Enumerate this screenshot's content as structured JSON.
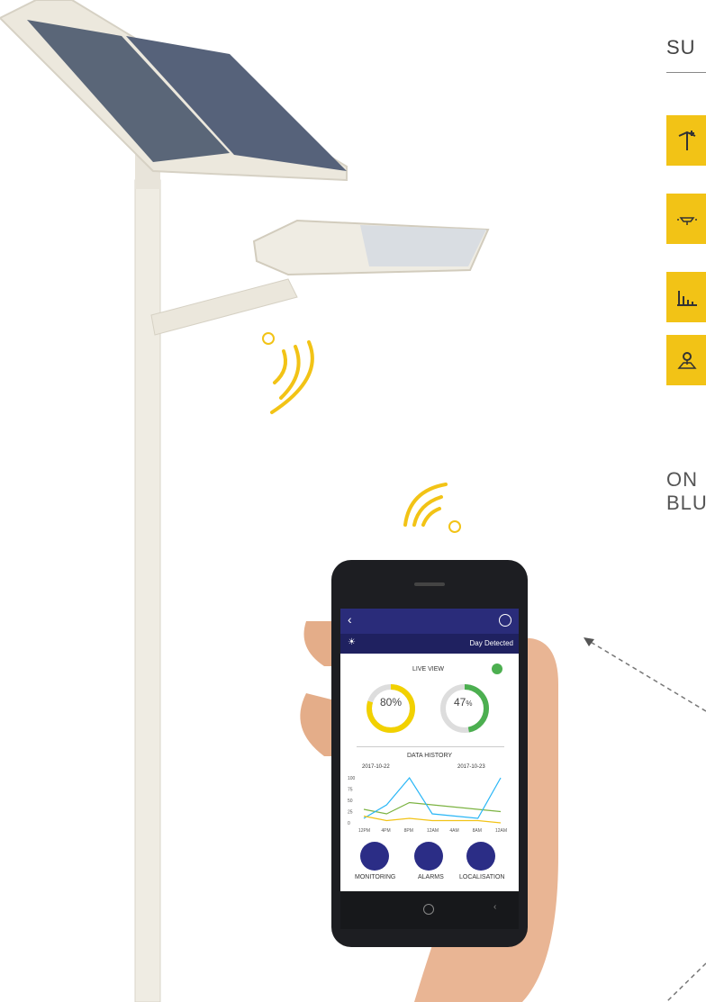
{
  "panel": {
    "title": "SU",
    "tiles": [
      "pole-icon",
      "lamp-icon",
      "bars-chart-icon",
      "map-pin-icon"
    ],
    "note": "ON\nBLU"
  },
  "app": {
    "status_text": "Day Detected",
    "live_view_label": "LIVE VIEW",
    "battery_percent": "80%",
    "charge_percent_value": "47",
    "charge_percent_unit": "%",
    "history_label": "DATA HISTORY",
    "date_left": "2017-10-22",
    "date_right": "2017-10-23",
    "y_ticks": [
      "100",
      "75",
      "50",
      "25",
      "0"
    ],
    "x_ticks": [
      "12PM",
      "4PM",
      "8PM",
      "12AM",
      "4AM",
      "8AM",
      "12AM"
    ],
    "buttons": [
      "MONITORING",
      "ALARMS",
      "LOCALISATION"
    ]
  },
  "colors": {
    "accent": "#f2c316",
    "navy": "#2a2c7a",
    "green": "#4caf50"
  },
  "chart_data": {
    "type": "line",
    "x": [
      "12PM",
      "4PM",
      "8PM",
      "12AM",
      "4AM",
      "8AM",
      "12AM"
    ],
    "ylim": [
      0,
      100
    ],
    "series": [
      {
        "values": [
          30,
          20,
          45,
          40,
          35,
          30,
          25
        ]
      },
      {
        "values": [
          10,
          40,
          100,
          20,
          15,
          10,
          100
        ]
      },
      {
        "values": [
          15,
          5,
          10,
          5,
          5,
          5,
          0
        ]
      }
    ]
  }
}
